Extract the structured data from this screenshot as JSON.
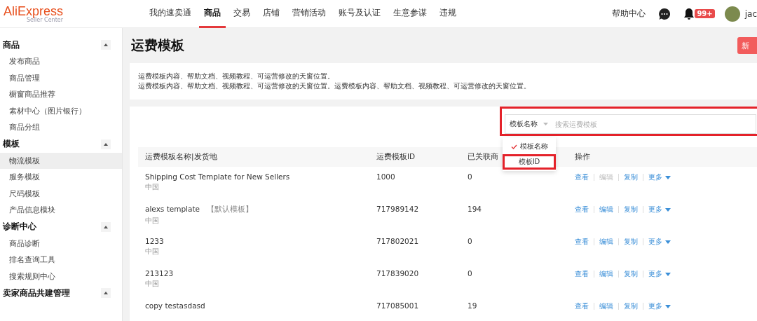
{
  "header": {
    "logo": "AliExpress",
    "logo_sub": "Seller Center",
    "nav": [
      {
        "label": "我的速卖通",
        "selected": false
      },
      {
        "label": "商品",
        "selected": true
      },
      {
        "label": "交易",
        "selected": false
      },
      {
        "label": "店铺",
        "selected": false
      },
      {
        "label": "营销活动",
        "selected": false
      },
      {
        "label": "账号及认证",
        "selected": false
      },
      {
        "label": "生意参谋",
        "selected": false
      },
      {
        "label": "违规",
        "selected": false
      }
    ],
    "help": "帮助中心",
    "notification_badge": "99+",
    "user": "jac"
  },
  "sidebar": {
    "groups": [
      {
        "title": "商品",
        "expanded": true,
        "items": [
          {
            "label": "发布商品",
            "selected": false
          },
          {
            "label": "商品管理",
            "selected": false
          },
          {
            "label": "橱窗商品推荐",
            "selected": false
          },
          {
            "label": "素材中心（图片银行）",
            "selected": false
          },
          {
            "label": "商品分组",
            "selected": false
          }
        ]
      },
      {
        "title": "模板",
        "expanded": true,
        "items": [
          {
            "label": "物流模板",
            "selected": true
          },
          {
            "label": "服务模板",
            "selected": false
          },
          {
            "label": "尺码模板",
            "selected": false
          },
          {
            "label": "产品信息模块",
            "selected": false
          }
        ]
      },
      {
        "title": "诊断中心",
        "expanded": true,
        "items": [
          {
            "label": "商品诊断",
            "selected": false
          },
          {
            "label": "排名查询工具",
            "selected": false
          },
          {
            "label": "搜索规则中心",
            "selected": false
          }
        ]
      },
      {
        "title": "卖家商品共建管理",
        "expanded": true
      }
    ]
  },
  "page": {
    "title": "运费模板",
    "new_button": "新",
    "notice": [
      "运费模板内容、帮助文档、视频教程、可运营修改的天窗位置。",
      "运费模板内容、帮助文档、视频教程、可运营修改的天窗位置。运费模板内容、帮助文档、视频教程、可运营修改的天窗位置。"
    ]
  },
  "search": {
    "type_select": "模板名称",
    "placeholder": "搜索运费模板",
    "annotated": true,
    "dropdown": [
      {
        "label": "模板名称",
        "selected": true,
        "annotated": false
      },
      {
        "label": "模板ID",
        "selected": false,
        "annotated": true
      }
    ]
  },
  "table": {
    "columns": [
      "运费模板名称|发货地",
      "运费模板ID",
      "已关联商",
      "操作"
    ],
    "rows": [
      {
        "name": "Shipping Cost Template for New Sellers",
        "tag": null,
        "origin": "中国",
        "id": "1000",
        "count": "0",
        "actions": [
          {
            "label": "查看",
            "disabled": false
          },
          {
            "label": "编辑",
            "disabled": true
          },
          {
            "label": "复制",
            "disabled": false
          }
        ],
        "more": "更多"
      },
      {
        "name": "alexs template",
        "tag": "【默认模板】",
        "origin": "中国",
        "id": "717989142",
        "count": "194",
        "actions": [
          {
            "label": "查看",
            "disabled": false
          },
          {
            "label": "编辑",
            "disabled": false
          },
          {
            "label": "复制",
            "disabled": false
          }
        ],
        "more": "更多"
      },
      {
        "name": "1233",
        "tag": null,
        "origin": "中国",
        "id": "717802021",
        "count": "0",
        "actions": [
          {
            "label": "查看",
            "disabled": false
          },
          {
            "label": "编辑",
            "disabled": false
          },
          {
            "label": "复制",
            "disabled": false
          }
        ],
        "more": "更多"
      },
      {
        "name": "213123",
        "tag": null,
        "origin": "中国",
        "id": "717839020",
        "count": "0",
        "actions": [
          {
            "label": "查看",
            "disabled": false
          },
          {
            "label": "编辑",
            "disabled": false
          },
          {
            "label": "复制",
            "disabled": false
          }
        ],
        "more": "更多"
      },
      {
        "name": "copy testasdasd",
        "tag": null,
        "origin": null,
        "id": "717085001",
        "count": "19",
        "actions": [
          {
            "label": "查看",
            "disabled": false
          },
          {
            "label": "编辑",
            "disabled": false
          },
          {
            "label": "复制",
            "disabled": false
          }
        ],
        "more": "更多"
      }
    ]
  }
}
